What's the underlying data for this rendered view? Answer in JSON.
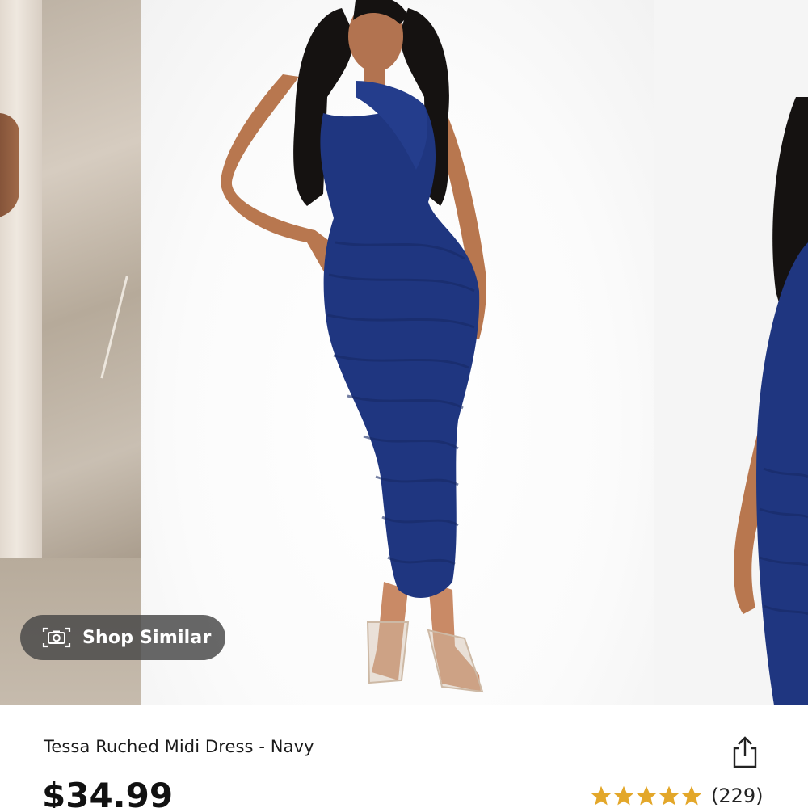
{
  "product": {
    "title": "Tessa Ruched Midi Dress - Navy",
    "price": "$34.99",
    "rating_value": 5,
    "review_count": "(229)"
  },
  "gallery": {
    "shop_similar_label": "Shop Similar",
    "camera_icon": "camera-icon"
  },
  "icons": {
    "share": "share-icon",
    "star": "star-icon"
  },
  "colors": {
    "dress": "#1f3680",
    "star": "#e3a72a",
    "pill_bg": "#464646"
  }
}
